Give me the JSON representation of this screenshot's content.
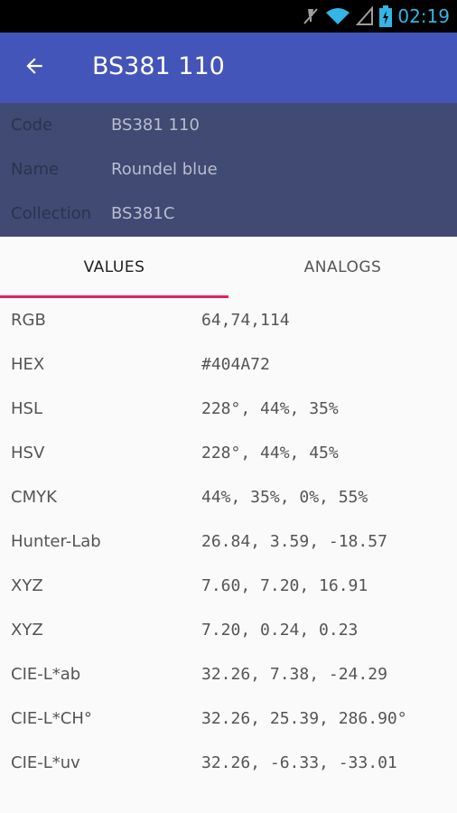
{
  "status_bar": {
    "time": "02:19",
    "icons": [
      "mute-icon",
      "wifi-icon",
      "signal-icon",
      "battery-charging-icon"
    ],
    "accent": "#33b5e5"
  },
  "app_bar": {
    "title": "BS381 110",
    "color": "#4355b8",
    "back_icon": "arrow-back-icon"
  },
  "info": {
    "background": "#404a72",
    "rows": [
      {
        "label": "Code",
        "value": "BS381 110"
      },
      {
        "label": "Name",
        "value": "Roundel blue"
      },
      {
        "label": "Collection",
        "value": "BS381C"
      }
    ]
  },
  "tabs": {
    "items": [
      {
        "label": "VALUES",
        "selected": true
      },
      {
        "label": "ANALOGS",
        "selected": false
      }
    ],
    "indicator_color": "#e91e63"
  },
  "values": [
    {
      "label": "RGB",
      "value": "64,74,114"
    },
    {
      "label": "HEX",
      "value": "#404A72"
    },
    {
      "label": "HSL",
      "value": "228°, 44%, 35%"
    },
    {
      "label": "HSV",
      "value": "228°, 44%, 45%"
    },
    {
      "label": "CMYK",
      "value": "44%, 35%, 0%, 55%"
    },
    {
      "label": "Hunter-Lab",
      "value": "26.84, 3.59, -18.57"
    },
    {
      "label": "XYZ",
      "value": "7.60, 7.20, 16.91"
    },
    {
      "label": "XYZ",
      "value": "7.20, 0.24, 0.23"
    },
    {
      "label": "CIE-L*ab",
      "value": "32.26, 7.38, -24.29"
    },
    {
      "label": "CIE-L*CH°",
      "value": "32.26, 25.39, 286.90°"
    },
    {
      "label": "CIE-L*uv",
      "value": "32.26, -6.33, -33.01"
    }
  ]
}
